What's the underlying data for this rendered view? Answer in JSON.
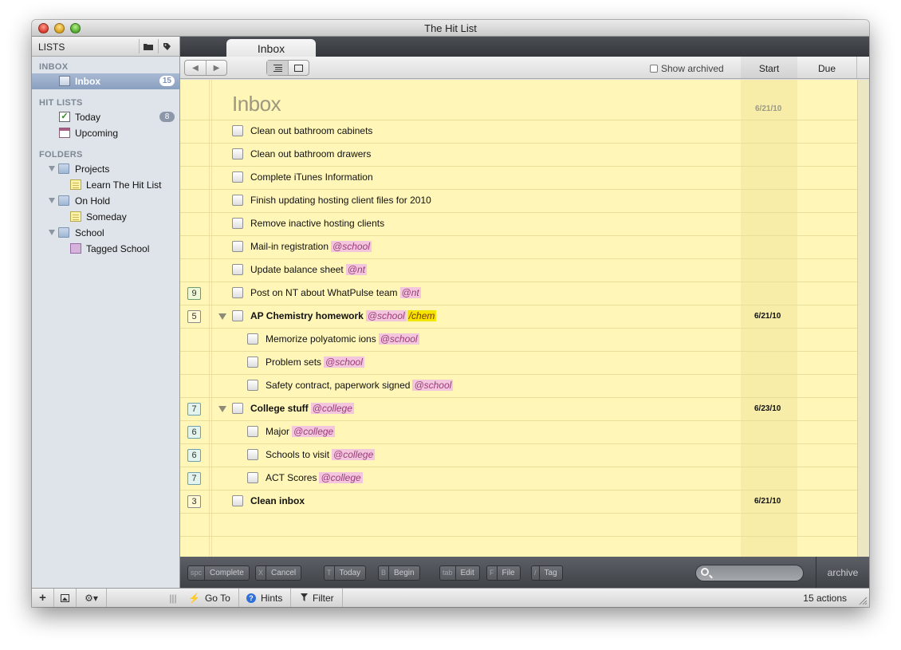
{
  "window": {
    "title": "The Hit List"
  },
  "sidebar": {
    "header": "LISTS",
    "sections": {
      "inbox": "INBOX",
      "hit_lists": "HIT LISTS",
      "folders": "FOLDERS"
    },
    "inbox_item": {
      "label": "Inbox",
      "count": "15"
    },
    "today": {
      "label": "Today",
      "count": "8"
    },
    "upcoming": {
      "label": "Upcoming"
    },
    "projects": {
      "label": "Projects"
    },
    "learn": {
      "label": "Learn The Hit List"
    },
    "onhold": {
      "label": "On Hold"
    },
    "someday": {
      "label": "Someday"
    },
    "school": {
      "label": "School"
    },
    "tagged_school": {
      "label": "Tagged School"
    }
  },
  "main": {
    "tab": "Inbox",
    "show_archived": "Show archived",
    "columns": {
      "start": "Start",
      "due": "Due"
    },
    "list_title": "Inbox",
    "list_start": "6/21/10",
    "tasks": [
      {
        "label": "Clean out bathroom cabinets"
      },
      {
        "label": "Clean out bathroom drawers"
      },
      {
        "label": "Complete iTunes Information"
      },
      {
        "label": "Finish updating hosting client files for 2010"
      },
      {
        "label": "Remove inactive hosting clients"
      },
      {
        "label": "Mail-in registration",
        "tag": "@school"
      },
      {
        "label": "Update balance sheet",
        "tag": "@nt"
      },
      {
        "priority": "9",
        "label": "Post on NT about WhatPulse team",
        "tag": "@nt"
      },
      {
        "priority": "5",
        "label": "AP Chemistry homework",
        "tag": "@school",
        "tag2": "/chem",
        "start": "6/21/10"
      },
      {
        "label": "Memorize polyatomic ions",
        "tag": "@school"
      },
      {
        "label": "Problem sets",
        "tag": "@school"
      },
      {
        "label": "Safety contract, paperwork signed",
        "tag": "@school"
      },
      {
        "priority": "7",
        "label": "College stuff",
        "tag": "@college",
        "start": "6/23/10"
      },
      {
        "priority": "6",
        "label": "Major",
        "tag": "@college"
      },
      {
        "priority": "6",
        "label": "Schools to visit",
        "tag": "@college"
      },
      {
        "priority": "7",
        "label": "ACT Scores",
        "tag": "@college"
      },
      {
        "priority": "3",
        "label": "Clean inbox",
        "start": "6/21/10"
      }
    ]
  },
  "actionbar": {
    "complete": {
      "key": "spc",
      "label": "Complete"
    },
    "cancel": {
      "key": "X",
      "label": "Cancel"
    },
    "today": {
      "key": "T",
      "label": "Today"
    },
    "begin": {
      "key": "B",
      "label": "Begin"
    },
    "edit": {
      "key": "tab",
      "label": "Edit"
    },
    "file": {
      "key": "F",
      "label": "File"
    },
    "tag": {
      "key": "/",
      "label": "Tag"
    },
    "archive": "archive"
  },
  "statusbar": {
    "goto": "Go To",
    "hints": "Hints",
    "filter": "Filter",
    "actions_count": "15 actions"
  },
  "colors": {
    "list_background": "#fff6b8",
    "tag_pink": "#f4c6dd",
    "tag_yellow": "#f4e400",
    "selection": "#8aa0c0"
  }
}
